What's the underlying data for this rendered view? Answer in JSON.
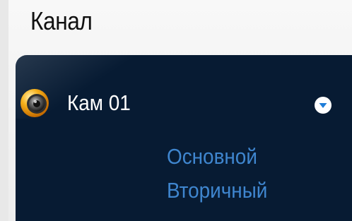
{
  "section": {
    "title": "Канал"
  },
  "channel": {
    "label": "Кам 01",
    "streams": [
      "Основной",
      "Вторичный"
    ]
  },
  "colors": {
    "panel_background": "#071b33",
    "stream_link": "#3f86cf",
    "camera_icon_ring": "#f2a316",
    "toggle_arrow": "#1f7dd8"
  }
}
